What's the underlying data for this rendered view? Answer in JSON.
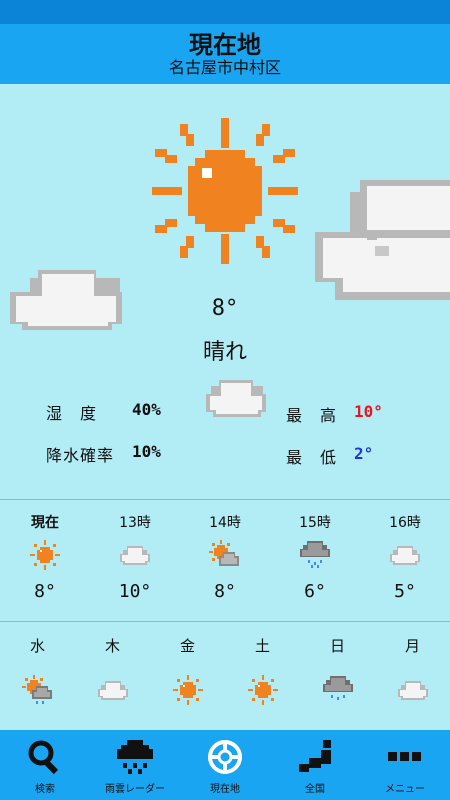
{
  "header": {
    "title": "現在地",
    "subtitle": "名古屋市中村区"
  },
  "current": {
    "temperature": "8°",
    "condition": "晴れ",
    "icon": "sun-icon",
    "humidity_label": "湿　度",
    "humidity_value": "40%",
    "precip_label": "降水確率",
    "precip_value": "10%",
    "high_label": "最　高",
    "high_value": "10°",
    "low_label": "最　低",
    "low_value": "2°",
    "colors": {
      "high": "#e8161f",
      "low": "#1f33dd",
      "sun": "#f0821f"
    }
  },
  "hourly": [
    {
      "label": "現在",
      "temp": "8°",
      "icon": "sun-icon"
    },
    {
      "label": "13時",
      "temp": "10°",
      "icon": "cloud-icon"
    },
    {
      "label": "14時",
      "temp": "8°",
      "icon": "sun-cloud-icon"
    },
    {
      "label": "15時",
      "temp": "6°",
      "icon": "rain-cloud-icon"
    },
    {
      "label": "16時",
      "temp": "5°",
      "icon": "cloud-icon"
    }
  ],
  "daily": [
    {
      "label": "水",
      "icon": "sun-rain-icon"
    },
    {
      "label": "木",
      "icon": "cloud-icon"
    },
    {
      "label": "金",
      "icon": "sun-icon"
    },
    {
      "label": "土",
      "icon": "sun-icon"
    },
    {
      "label": "日",
      "icon": "rain-cloud-icon"
    },
    {
      "label": "月",
      "icon": "cloud-icon"
    }
  ],
  "nav": [
    {
      "label": "検索",
      "icon": "search-icon"
    },
    {
      "label": "雨雲レーダー",
      "icon": "rain-radar-icon"
    },
    {
      "label": "現在地",
      "icon": "location-icon"
    },
    {
      "label": "全国",
      "icon": "nationwide-icon"
    },
    {
      "label": "メニュー",
      "icon": "menu-icon"
    }
  ]
}
